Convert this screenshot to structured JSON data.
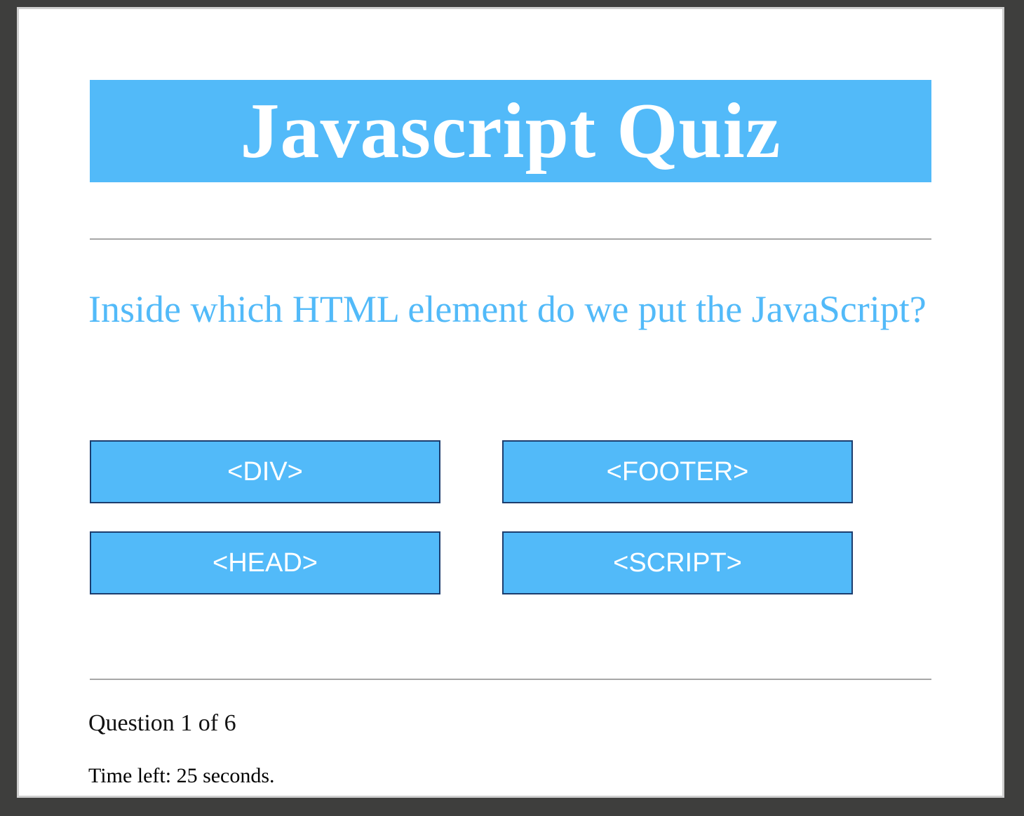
{
  "quiz": {
    "title": "Javascript Quiz",
    "question": "Inside which HTML element do we put the JavaScript?",
    "answers": [
      "<DIV>",
      "<FOOTER>",
      "<HEAD>",
      "<SCRIPT>"
    ],
    "progress": "Question 1 of 6",
    "timer": "Time left: 25 seconds."
  },
  "colors": {
    "accent": "#52baf9",
    "button_border": "#1c3d6e",
    "divider": "#a7a7a7",
    "outer_background": "#3e3e3d"
  }
}
